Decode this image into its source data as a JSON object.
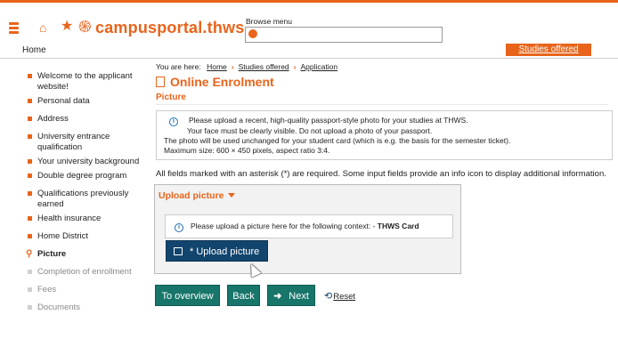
{
  "header": {
    "logo_text": "campusportal.thws",
    "browse_label": "Browse menu",
    "browse_placeholder": "",
    "icons": [
      "menu-icon",
      "home-icon",
      "star-icon",
      "logo-mark-icon",
      "search-icon"
    ],
    "accent_color": "#e8641b"
  },
  "nav": {
    "home_label": "Home",
    "studies_offered_label": "Studies offered"
  },
  "sidebar": {
    "items": [
      {
        "label": "Welcome to the applicant website!",
        "state": "done"
      },
      {
        "label": "Personal data",
        "state": "done"
      },
      {
        "label": "Address",
        "state": "done"
      },
      {
        "label": "University entrance qualification",
        "state": "done"
      },
      {
        "label": "Your university background",
        "state": "done"
      },
      {
        "label": "Double degree program",
        "state": "done"
      },
      {
        "label": "Qualifications previously earned",
        "state": "done"
      },
      {
        "label": "Health insurance",
        "state": "done"
      },
      {
        "label": "Home District",
        "state": "done"
      },
      {
        "label": "Picture",
        "state": "current"
      },
      {
        "label": "Completion of enrollment",
        "state": "disabled"
      },
      {
        "label": "Fees",
        "state": "disabled"
      },
      {
        "label": "Documents",
        "state": "disabled"
      }
    ]
  },
  "breadcrumb": {
    "prefix": "You are here:",
    "items": [
      "Home",
      "Studies offered",
      "Application"
    ]
  },
  "main": {
    "page_title": "Online Enrolment",
    "section_title": "Picture",
    "info_lines": [
      "Please upload a recent, high-quality passport-style photo for your studies at THWS.",
      "Your face must be clearly visible. Do not upload a photo of your passport.",
      "The photo will be used unchanged for your student card (which is e.g. the basis for the semester ticket).",
      "Maximum size: 600 × 450 pixels, aspect ratio 3:4."
    ],
    "required_note": "All fields marked with an asterisk (*) are required. Some input fields provide an info icon to display additional information.",
    "upload": {
      "header": "Upload picture",
      "info_text": "Please upload a picture here for the following context: - ",
      "info_context": "THWS Card",
      "button_label": "* Upload picture"
    },
    "actions": {
      "overview": "To overview",
      "back": "Back",
      "next": "Next",
      "reset": "Reset"
    }
  },
  "colors": {
    "accent": "#e8641b",
    "primary_button": "#17756a",
    "upload_button": "#12456e"
  }
}
